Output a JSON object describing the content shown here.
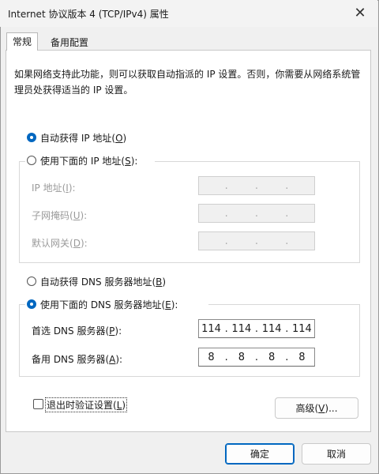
{
  "window": {
    "title": "Internet 协议版本 4 (TCP/IPv4) 属性",
    "close_glyph": "✕"
  },
  "tabs": [
    {
      "label": "常规",
      "active": true
    },
    {
      "label": "备用配置",
      "active": false
    }
  ],
  "description": "如果网络支持此功能，则可以获取自动指派的 IP 设置。否则，你需要从网络系统管理员处获得适当的 IP 设置。",
  "ip_section": {
    "auto_label_prefix": "自动获得 IP 地址(",
    "auto_label_key": "O",
    "auto_label_suffix": ")",
    "manual_label_prefix": "使用下面的 IP 地址(",
    "manual_label_key": "S",
    "manual_label_suffix": "):",
    "auto_selected": true,
    "fields": [
      {
        "label_prefix": "IP 地址(",
        "key": "I",
        "label_suffix": "):",
        "octets": [
          "",
          "",
          "",
          ""
        ]
      },
      {
        "label_prefix": "子网掩码(",
        "key": "U",
        "label_suffix": "):",
        "octets": [
          "",
          "",
          "",
          ""
        ]
      },
      {
        "label_prefix": "默认网关(",
        "key": "D",
        "label_suffix": "):",
        "octets": [
          "",
          "",
          "",
          ""
        ]
      }
    ]
  },
  "dns_section": {
    "auto_label_prefix": "自动获得 DNS 服务器地址(",
    "auto_label_key": "B",
    "auto_label_suffix": ")",
    "manual_label_prefix": "使用下面的 DNS 服务器地址(",
    "manual_label_key": "E",
    "manual_label_suffix": "):",
    "manual_selected": true,
    "preferred": {
      "label_prefix": "首选 DNS 服务器(",
      "key": "P",
      "label_suffix": "):",
      "octets": [
        "114",
        "114",
        "114",
        "114"
      ]
    },
    "alternate": {
      "label_prefix": "备用 DNS 服务器(",
      "key": "A",
      "label_suffix": "):",
      "octets": [
        "8",
        "8",
        "8",
        "8"
      ]
    }
  },
  "validate": {
    "label_prefix": "退出时验证设置(",
    "key": "L",
    "label_suffix": ")",
    "checked": false
  },
  "advanced_button": {
    "label_prefix": "高级(",
    "key": "V",
    "label_suffix": ")..."
  },
  "ok_button": "确定",
  "cancel_button": "取消"
}
